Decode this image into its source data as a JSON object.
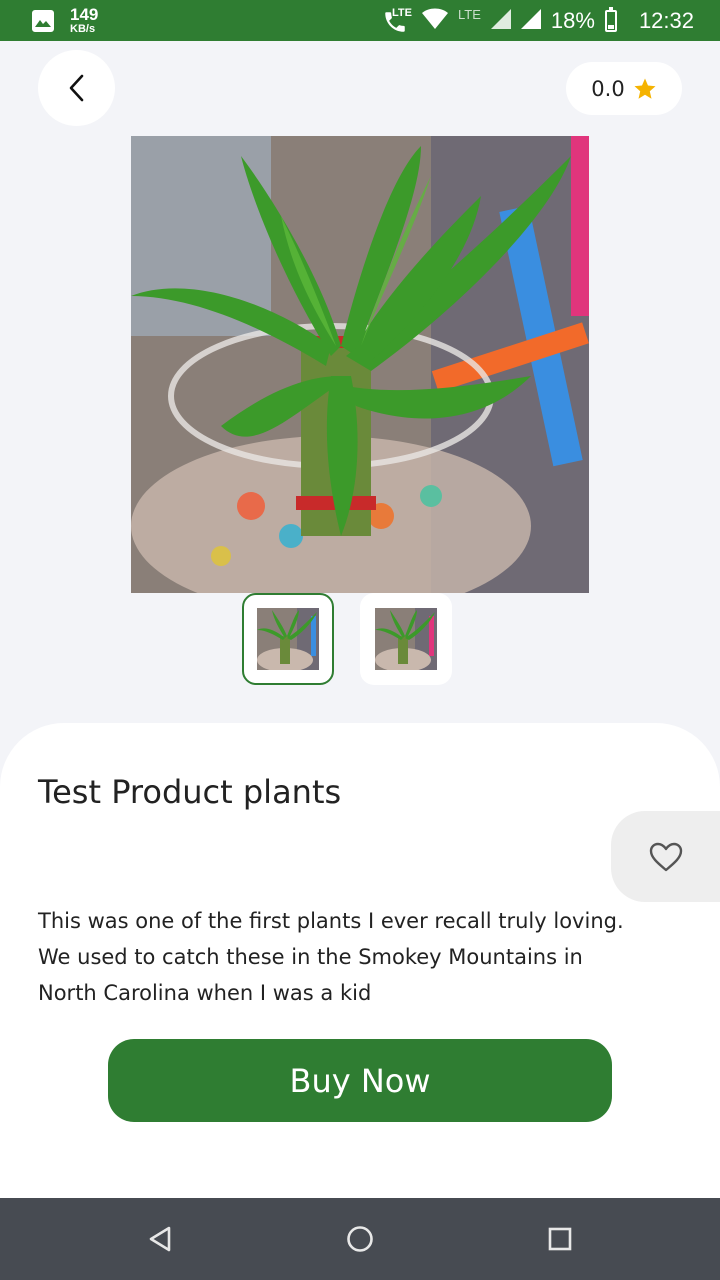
{
  "status_bar": {
    "net_speed_value": "149",
    "net_speed_unit": "KB/s",
    "call_badge": "LTE",
    "network_label": "LTE",
    "battery_percent": "18%",
    "time": "12:32"
  },
  "header": {
    "back_icon": "chevron-left-icon",
    "rating": "0.0",
    "rating_icon": "star-icon",
    "star_color": "#f5b301"
  },
  "gallery": {
    "thumbnails": [
      {
        "selected": true
      },
      {
        "selected": false
      }
    ]
  },
  "product": {
    "title": "Test Product plants",
    "description": "This was one of the first plants I ever recall truly loving. We used to catch these in the Smokey Mountains in North Carolina when I was a kid",
    "favorite_icon": "heart-outline-icon",
    "buy_label": "Buy Now"
  },
  "colors": {
    "brand_green": "#2f7d32",
    "background": "#f3f4f8",
    "nav_bar": "#474b52"
  }
}
